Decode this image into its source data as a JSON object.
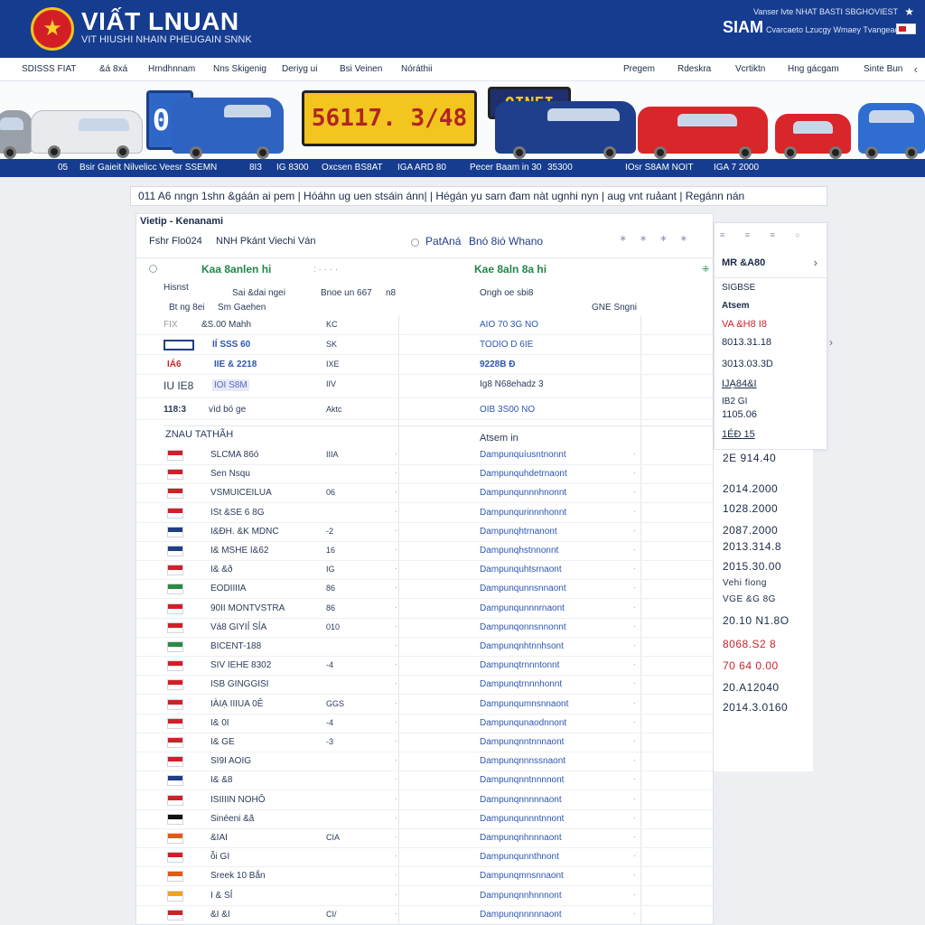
{
  "header": {
    "title": "VIẤT LNUAN",
    "subtitle": "VIT HIUSHI NHAIN PHEUGAIN SNNK",
    "right_top": "Vanser lvte NHAT BASTI SBGHOVIEST",
    "right_title": "SIAM",
    "right_sub": "Cvarcaeto Lzucgy Wmaey Tvangeaoe"
  },
  "nav": {
    "items": [
      "SDISSS FIAT",
      "&á 8xá",
      "Hrndhnnam",
      "Nns Skigenig",
      "Deriyg ui",
      "Bsi Veinen",
      "Nóráthii",
      "Pregem",
      "Rdeskra",
      "Vcrtiktn",
      "Hng gácgam",
      "Sinte Bun"
    ],
    "more": "‹"
  },
  "banner": {
    "plate_blue": "01",
    "plate_yellow": "56117.  3/48",
    "plate_dark": "OINFI"
  },
  "ticker": [
    "05",
    "Bsir Gaieit Nilvelicc Veesr SSEMN",
    "8I3",
    "IG 8300",
    "Oxcsen BS8AT",
    "IGA ARD 80",
    "Pecer Baam  in 30",
    "35300",
    "IOsr S8AM NOIT",
    "IGA 7 2000"
  ],
  "notice": "011 A6 nngn 1shn &gáán ai pem | Hóáhn ug uen stsáin ánn| | Hégán yu sarn  đam nàt ugnhi nyn | aug vnt ruảant | Regánn nán",
  "panel": {
    "breadcrumb": "Vietip - Kenanami",
    "row1_left": "Fshr Flo024",
    "row1_mid": "NNH Pkánt Viechi Ván",
    "tab1": "PatAná",
    "tab2": "Bnó 8ió Whano",
    "green_left": "Kaa 8anlen hi",
    "green_right": "Kae 8aln 8a hi",
    "g_row_a": "Hisnst",
    "g_row_b": "Sai &dai ngei",
    "g_row_c": "Bnoe un 667",
    "g_row_d": "n8",
    "g_row_e": "Ongh oe sbi8",
    "g_row_f": "Bt ng 8ei",
    "g_row_g": "Sm Gaehen",
    "g_row_h": "GNE Sngni",
    "lr1_name": "&S.00 Mahh",
    "lr1_code": "KC",
    "lr1_plate": "AIO 70 3G NO",
    "lr2_name": "IÍ SSS 60",
    "lr2_code": "SK",
    "lr2_plate": "TODIO D 6IE",
    "lr3_name": "IIE & 2218",
    "lr3_code": "IXE",
    "lr3_plate": "9228B Đ",
    "lr4_name": "IOI S8M",
    "lr4_code": "IIV",
    "lr4_plate": "Ig8 N68ehadz 3",
    "lr5_name": "vìd bó ge",
    "lr5_code": "Aktc",
    "lr5_plate": "OIB 3S00 NO",
    "section_left": "ZNAU TATHÃH",
    "section_right": "Atsem in",
    "list": [
      {
        "name": "SLCMA 86ó",
        "code": "IIIA",
        "plate": "Dampunquíusntnonnt"
      },
      {
        "name": "Sen Nsqu",
        "code": "",
        "plate": "Dampunquhdetrnaont"
      },
      {
        "name": "VSMUICEILUA",
        "code": "06",
        "plate": "Dampunqunnnhnonnt"
      },
      {
        "name": "ISt &SE 6 8G",
        "code": "",
        "plate": "Dampunqurinnnhonnt"
      },
      {
        "name": "I&ĐH. &K MDNC",
        "code": "-2",
        "plate": "Dampunqhtrnanont"
      },
      {
        "name": "I& MSHE I&62",
        "code": "16",
        "plate": "Dampunqhstnnonnt"
      },
      {
        "name": "I& &ð",
        "code": "IG",
        "plate": "Dampunquhtsrnaont"
      },
      {
        "name": "EODIIIIA",
        "code": "86",
        "plate": "Dampunqunnsnnaont"
      },
      {
        "name": "90II MONTVSTRA",
        "code": "86",
        "plate": "Dampunqunnnrnaont"
      },
      {
        "name": "Vá8 GIYIỈ SỈA",
        "code": "010",
        "plate": "Dampunqonnsnnonnt"
      },
      {
        "name": "BICENT-188",
        "code": "",
        "plate": "Dampunqnhtnnhsont"
      },
      {
        "name": "SIV IEHE 8302",
        "code": "-4",
        "plate": "Dampunqtrnnntonnt"
      },
      {
        "name": "ISB GINGGISI",
        "code": "",
        "plate": "Dampunqtrnnnhonnt"
      },
      {
        "name": "IÀIẠ IIIUA 0Ê",
        "code": "GGS",
        "plate": "Dampunqumnsnnaont"
      },
      {
        "name": "I& 0I",
        "code": "-4",
        "plate": "Dampunqunaodnnont"
      },
      {
        "name": "I& GE",
        "code": "-3",
        "plate": "Dampunqnntnnnaont"
      },
      {
        "name": "SI9I AOIG",
        "code": "",
        "plate": "Dampunqnnnssnaont"
      },
      {
        "name": "I& &8",
        "code": "",
        "plate": "Dampunqnntnnnnont"
      },
      {
        "name": "ISIIIIN NOHÔ",
        "code": "",
        "plate": "Dampunqnnnnnaont"
      },
      {
        "name": "Sinéeni &ă",
        "code": "",
        "plate": "Dampunqunnntnnont"
      },
      {
        "name": "&IAI",
        "code": "CIA",
        "plate": "Dampunqnhnnnaont"
      },
      {
        "name": "ỗi GI",
        "code": "",
        "plate": "Dampunqunnthnont"
      },
      {
        "name": "Sreek 10 Bắn",
        "code": "",
        "plate": "Dampunqmnsnnaont"
      },
      {
        "name": "I & SỈ",
        "code": "",
        "plate": "Dampunqnnhnnnont"
      },
      {
        "name": "&I &I",
        "code": "CI/",
        "plate": "Dampunqnnnnnaont"
      }
    ],
    "flag_colors": [
      "#d21f26",
      "#d21f26",
      "#d21f26",
      "#d21f26",
      "#1f3e86",
      "#1f3e86",
      "#d21f26",
      "#2a8a44",
      "#d21f26",
      "#d21f26",
      "#2a8a44",
      "#d21f26",
      "#d21f26",
      "#d21f26",
      "#d21f26",
      "#d21f26",
      "#d21f26",
      "#1f3e86",
      "#d21f26",
      "#111111",
      "#e05a10",
      "#d21f26",
      "#e05a10",
      "#f3a41a",
      "#d21f26"
    ]
  },
  "side": {
    "tools": "≡ ≡ ≡ ○",
    "head": "MR &A80",
    "chev": "›",
    "label1": "SIGBSE",
    "label2": "Atsem",
    "v1": "VA &H8 I8",
    "v2": "8013.31.18",
    "v3": "3013.03.3D",
    "v4": "IJẠ84&I",
    "v5": "IB2 GI",
    "v6": "1105.06",
    "v7": "1ÉĐ 15",
    "pager": "›"
  },
  "side_list": [
    {
      "text": "2E 914.40",
      "color": "#1b2a48"
    },
    {
      "text": "2014.2000",
      "color": "#1b2a48"
    },
    {
      "text": "1028.2000",
      "color": "#1b2a48"
    },
    {
      "text": "2087.2000",
      "color": "#1b2a48"
    },
    {
      "text": "2013.314.8",
      "color": "#1b2a48"
    },
    {
      "text": "2015.30.00",
      "color": "#1b2a48"
    },
    {
      "text": "Vehi fiong",
      "color": "#1b2a48"
    },
    {
      "text": "VGE &G 8G",
      "color": "#1b2a48"
    },
    {
      "text": "20.10 N1.8O",
      "color": "#1b2a48"
    },
    {
      "text": "8068.S2 8",
      "color": "#c7252b"
    },
    {
      "text": "70 64 0.00",
      "color": "#c7252b"
    },
    {
      "text": "20.A12040",
      "color": "#1b2a48"
    },
    {
      "text": "2014.3.0160",
      "color": "#1b2a48"
    }
  ]
}
